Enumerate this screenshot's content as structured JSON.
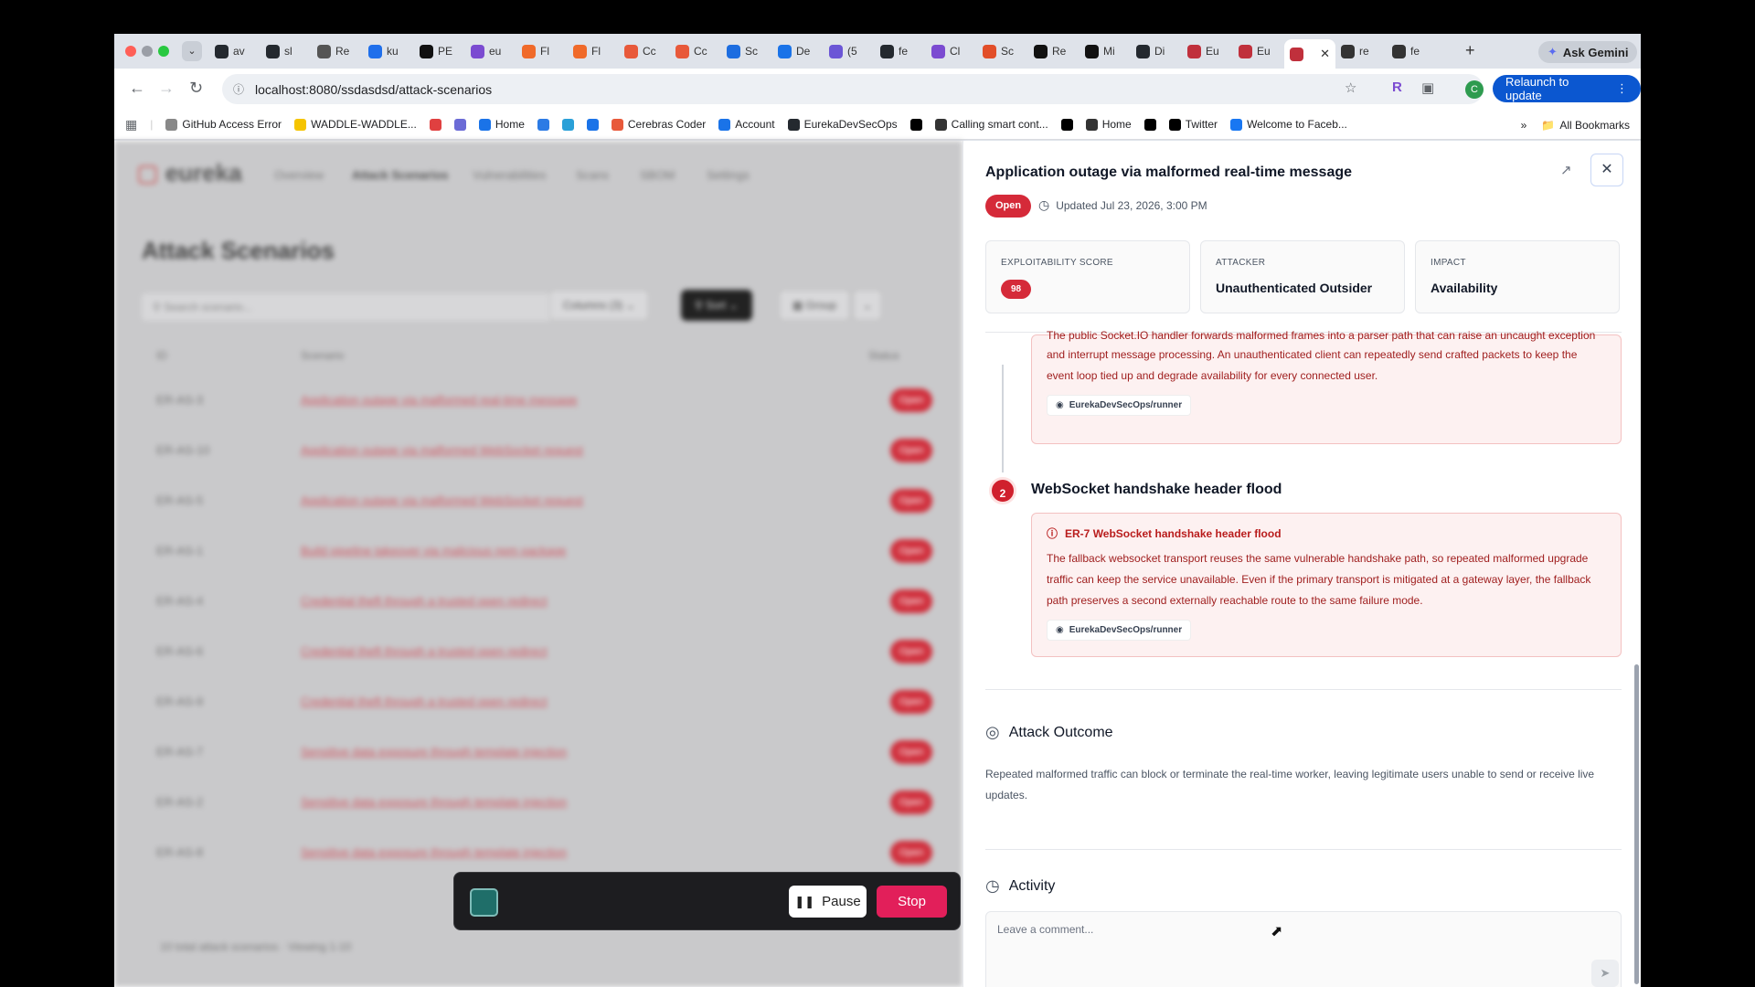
{
  "browser": {
    "tabs": [
      {
        "label": "av",
        "icon": "github-icon",
        "color": "#24292f"
      },
      {
        "label": "sl",
        "icon": "github-icon",
        "color": "#24292f"
      },
      {
        "label": "Re",
        "icon": "site-icon",
        "color": "#555555"
      },
      {
        "label": "ku",
        "icon": "site-icon",
        "color": "#1f6feb"
      },
      {
        "label": "PE",
        "icon": "site-icon",
        "color": "#111111"
      },
      {
        "label": "eu",
        "icon": "site-icon",
        "color": "#7b4bd1"
      },
      {
        "label": "Fl",
        "icon": "site-icon",
        "color": "#f06a2a"
      },
      {
        "label": "Fl",
        "icon": "site-icon",
        "color": "#f06a2a"
      },
      {
        "label": "Cc",
        "icon": "site-icon",
        "color": "#e8593a"
      },
      {
        "label": "Cc",
        "icon": "site-icon",
        "color": "#e8593a"
      },
      {
        "label": "Sc",
        "icon": "site-icon",
        "color": "#1d6de0"
      },
      {
        "label": "De",
        "icon": "site-icon",
        "color": "#1a73e8"
      },
      {
        "label": "(5",
        "icon": "site-icon",
        "color": "#6b56d6"
      },
      {
        "label": "fe",
        "icon": "github-icon",
        "color": "#24292f"
      },
      {
        "label": "Cl",
        "icon": "site-icon",
        "color": "#7b4bd1"
      },
      {
        "label": "Sc",
        "icon": "site-icon",
        "color": "#e24e29"
      },
      {
        "label": "Re",
        "icon": "site-icon",
        "color": "#111111"
      },
      {
        "label": "Mi",
        "icon": "site-icon",
        "color": "#111111"
      },
      {
        "label": "Di",
        "icon": "github-icon",
        "color": "#24292f"
      },
      {
        "label": "Eu",
        "icon": "site-icon",
        "color": "#c0303c"
      },
      {
        "label": "Eu",
        "icon": "site-icon",
        "color": "#c0303c"
      },
      {
        "label": "",
        "icon": "site-icon",
        "color": "#c0303c",
        "active": true
      },
      {
        "label": "re",
        "icon": "loading-icon",
        "color": "#333333"
      },
      {
        "label": "fe",
        "icon": "loading-icon",
        "color": "#333333"
      }
    ],
    "ask_gemini": "Ask Gemini",
    "url": "localhost:8080/ssdasdsd/attack-scenarios",
    "relaunch": "Relaunch to update",
    "profile_initial": "C",
    "bookmarks": [
      {
        "label": "GitHub Access Error",
        "color": "#888888"
      },
      {
        "label": "WADDLE-WADDLE...",
        "color": "#f5c400"
      },
      {
        "label": "",
        "color": "#e04040"
      },
      {
        "label": "",
        "color": "#6b6bd6"
      },
      {
        "label": "Home",
        "color": "#1a73e8"
      },
      {
        "label": "",
        "color": "#2c7be5"
      },
      {
        "label": "",
        "color": "#2aa0d8"
      },
      {
        "label": "",
        "color": "#1a73e8"
      },
      {
        "label": "Cerebras Coder",
        "color": "#e8593a"
      },
      {
        "label": "Account",
        "color": "#1a73e8"
      },
      {
        "label": "EurekaDevSecOps",
        "color": "#24292f"
      },
      {
        "label": "",
        "color": "#000000"
      },
      {
        "label": "Calling smart cont...",
        "color": "#333333"
      },
      {
        "label": "",
        "color": "#000000"
      },
      {
        "label": "Home",
        "color": "#333333"
      },
      {
        "label": "",
        "color": "#000000"
      },
      {
        "label": "Twitter",
        "color": "#000000"
      },
      {
        "label": "Welcome to Faceb...",
        "color": "#1877f2"
      }
    ],
    "all_bookmarks": "All Bookmarks"
  },
  "background_app": {
    "logo": "eureka",
    "nav": [
      "Overview",
      "Attack Scenarios",
      "Vulnerabilities",
      "Scans",
      "SBOM",
      "Settings"
    ],
    "title": "Attack Scenarios",
    "search_placeholder": "Search scenario...",
    "columns_btn": "Columns (3)",
    "sort_btn": "Sort",
    "group_btn": "Group",
    "headers": {
      "id": "ID",
      "scenario": "Scenario",
      "status": "Status"
    },
    "rows": [
      {
        "id": "ER-AS-3",
        "scenario": "Application outage via malformed real-time message",
        "status": "Open"
      },
      {
        "id": "ER-AS-10",
        "scenario": "Application outage via malformed WebSocket request",
        "status": "Open"
      },
      {
        "id": "ER-AS-5",
        "scenario": "Application outage via malformed WebSocket request",
        "status": "Open"
      },
      {
        "id": "ER-AS-1",
        "scenario": "Build pipeline takeover via malicious npm package",
        "status": "Open"
      },
      {
        "id": "ER-AS-4",
        "scenario": "Credential theft through a trusted open redirect",
        "status": "Open"
      },
      {
        "id": "ER-AS-6",
        "scenario": "Credential theft through a trusted open redirect",
        "status": "Open"
      },
      {
        "id": "ER-AS-9",
        "scenario": "Credential theft through a trusted open redirect",
        "status": "Open"
      },
      {
        "id": "ER-AS-7",
        "scenario": "Sensitive data exposure through template injection",
        "status": "Open"
      },
      {
        "id": "ER-AS-2",
        "scenario": "Sensitive data exposure through template injection",
        "status": "Open"
      },
      {
        "id": "ER-AS-8",
        "scenario": "Sensitive data exposure through template injection",
        "status": "Open"
      }
    ],
    "footer": "10 total attack scenarios · Viewing 1-10"
  },
  "recording": {
    "pause": "Pause",
    "stop": "Stop"
  },
  "panel": {
    "title": "Application outage via malformed real-time message",
    "status": "Open",
    "updated": "Updated Jul 23, 2026, 3:00 PM",
    "cards": {
      "exploitability_label": "EXPLOITABILITY SCORE",
      "exploitability_value": "98",
      "attacker_label": "ATTACKER",
      "attacker_value": "Unauthenticated Outsider",
      "impact_label": "IMPACT",
      "impact_value": "Availability"
    },
    "finding1": {
      "text_top": "The public Socket.IO handler forwards malformed frames into a parser path that can raise an uncaught exception",
      "text_mid": "and interrupt message processing. An unauthenticated client can repeatedly send crafted packets to keep the",
      "text_bot": "event loop tied up and degrade availability for every connected user.",
      "repo": "EurekaDevSecOps/runner"
    },
    "step2": {
      "number": "2",
      "title": "WebSocket handshake header flood",
      "finding_title": "ER-7 WebSocket handshake header flood",
      "text_1": "The fallback websocket transport reuses the same vulnerable handshake path, so repeated malformed upgrade",
      "text_2": "traffic can keep the service unavailable. Even if the primary transport is mitigated at a gateway layer, the fallback",
      "text_3": "path preserves a second externally reachable route to the same failure mode.",
      "repo": "EurekaDevSecOps/runner"
    },
    "outcome": {
      "title": "Attack Outcome",
      "text": "Repeated malformed traffic can block or terminate the real-time worker, leaving legitimate users unable to send or receive live updates."
    },
    "activity": {
      "title": "Activity",
      "placeholder": "Leave a comment..."
    }
  }
}
